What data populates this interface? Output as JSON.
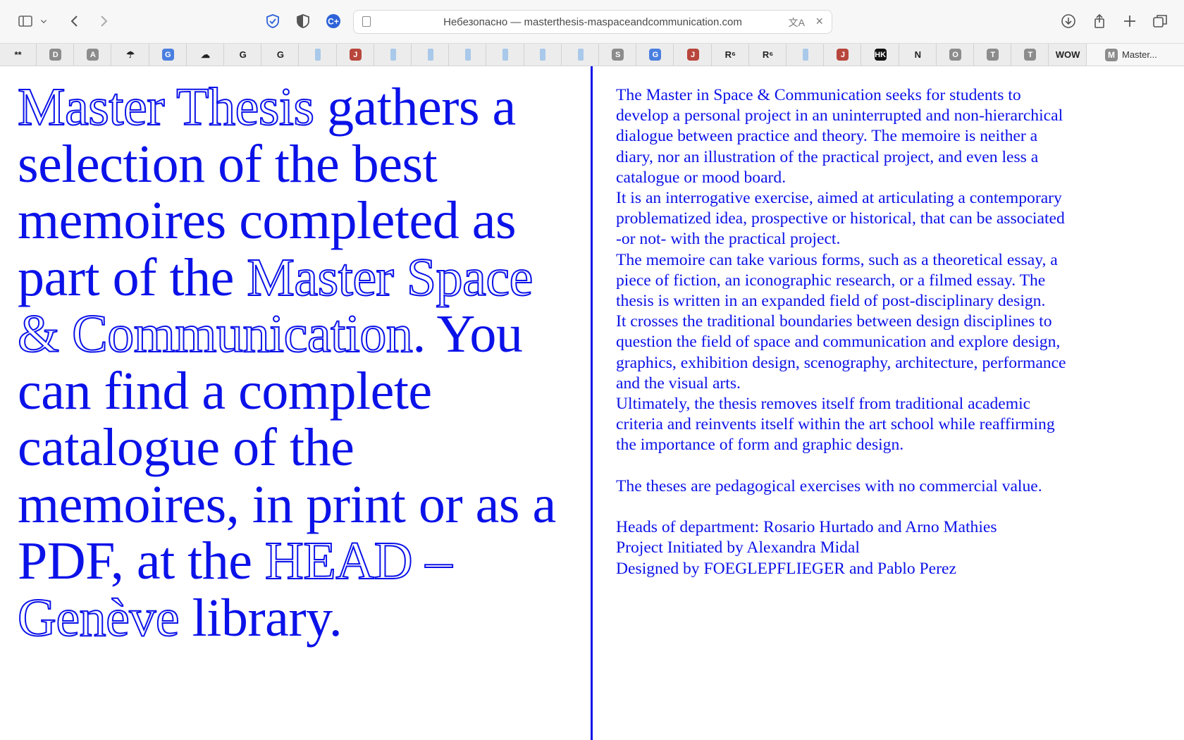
{
  "browser": {
    "address_text": "Небезопасно — masterthesis-maspaceandcommunication.com",
    "favorites": [
      {
        "icon": "**",
        "style": "plain"
      },
      {
        "icon": "D",
        "style": "grey"
      },
      {
        "icon": "A",
        "style": "grey"
      },
      {
        "icon": "☂",
        "style": "plain"
      },
      {
        "icon": "G",
        "style": "gt"
      },
      {
        "icon": "☁",
        "style": "plain"
      },
      {
        "icon": "G",
        "style": "plain"
      },
      {
        "icon": "G",
        "style": "plain"
      },
      {
        "icon": "",
        "style": "blue"
      },
      {
        "icon": "J",
        "style": "red"
      },
      {
        "icon": "",
        "style": "blue"
      },
      {
        "icon": "",
        "style": "blue"
      },
      {
        "icon": "",
        "style": "blue"
      },
      {
        "icon": "",
        "style": "blue"
      },
      {
        "icon": "",
        "style": "blue"
      },
      {
        "icon": "",
        "style": "blue"
      },
      {
        "icon": "S",
        "style": "grey"
      },
      {
        "icon": "G",
        "style": "gt"
      },
      {
        "icon": "J",
        "style": "red"
      },
      {
        "icon": "R⁶",
        "style": "plain"
      },
      {
        "icon": "R⁶",
        "style": "plain"
      },
      {
        "icon": "",
        "style": "blue"
      },
      {
        "icon": "J",
        "style": "red"
      },
      {
        "icon": "HK",
        "style": "black"
      },
      {
        "icon": "N",
        "style": "plain"
      },
      {
        "icon": "O",
        "style": "grey"
      },
      {
        "icon": "T",
        "style": "grey"
      },
      {
        "icon": "T",
        "style": "grey"
      },
      {
        "icon": "WOW",
        "style": "plain"
      }
    ],
    "active_tab": {
      "icon": "M",
      "label": "Master..."
    }
  },
  "intro": {
    "t1": "Master Thesis",
    "t2": " gathers a selection of the best memoires completed as part of the ",
    "t3": "Master Space & Communication",
    "t4": ". You can find a complete catalogue of the memoires, in print or as a PDF, at the ",
    "t5": "HEAD – Genève",
    "t6": " library."
  },
  "description": {
    "p1": "The Master in Space & Communication seeks for students to develop a personal project in an uninterrupted and non-hierarchical dialogue between practice and theory. The memoire is neither a diary, nor an illustration of the practical project, and even less a catalogue or mood board.",
    "p2": "It is an interrogative exercise, aimed at articulating a contemporary problematized idea, prospective or historical, that can be associated -or not- with the practical project.",
    "p3": "The memoire can take various forms, such as a theoretical essay, a piece of fiction, an iconographic research, or a filmed essay. The thesis is written in an expanded field of post-disciplinary design.",
    "p4": "It crosses the traditional boundaries between design disciplines to question the field of space and communication and explore design, graphics, exhibition design, scenography, architecture, performance and the visual arts.",
    "p5": "Ultimately, the thesis removes itself from traditional academic criteria and reinvents itself within the art school while reaffirming the importance of form and graphic design.",
    "p6": "The theses are pedagogical exercises with no commercial value.",
    "credit1": "Heads of department: Rosario Hurtado and Arno Mathies",
    "credit2": "Project Initiated by Alexandra Midal",
    "credit3": "Designed by FOEGLEPFLIEGER and Pablo Perez"
  }
}
